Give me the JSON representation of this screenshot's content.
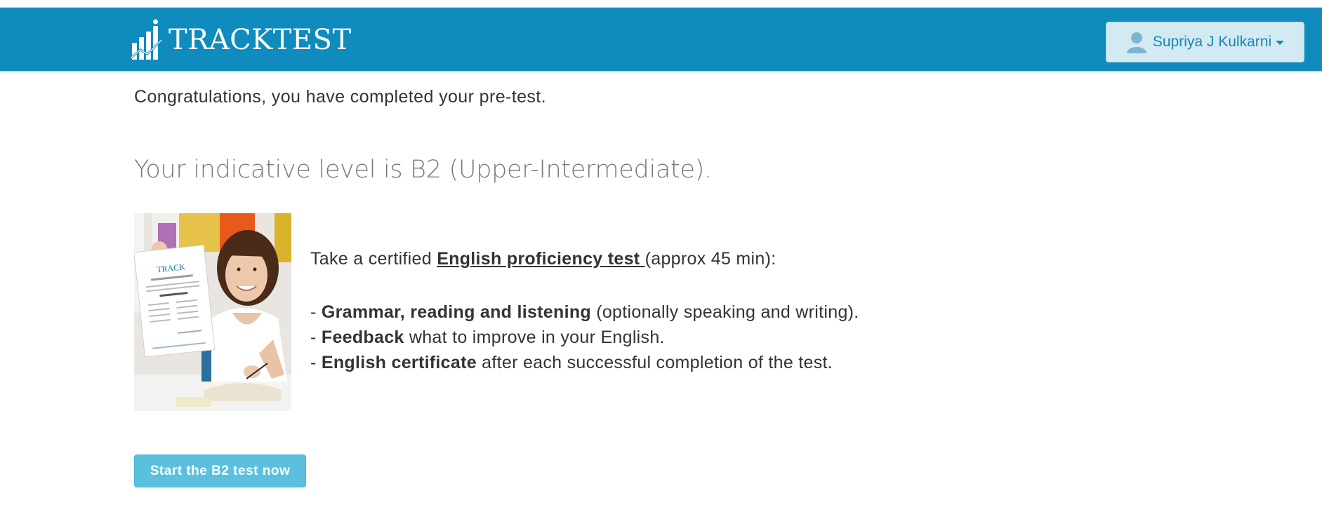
{
  "header": {
    "brand": "TRACKTEST",
    "brand_color": "#0f8bbd",
    "user_menu": {
      "name": "Supriya J Kulkarni",
      "icon": "user-icon"
    }
  },
  "main": {
    "congrats": "Congratulations, you have completed your pre-test.",
    "level": "Your indicative level is B2 (Upper-Intermediate).",
    "photo": {
      "certificate_brand": "TRACK"
    },
    "offer": {
      "prefix": "Take a certified ",
      "link": "English proficiency test ",
      "suffix": "(approx 45 min):"
    },
    "bullets": [
      {
        "dash": "- ",
        "bold": "Grammar, reading and listening",
        "rest": " (optionally speaking and writing)."
      },
      {
        "dash": "- ",
        "bold": "Feedback",
        "rest": " what to improve in your English."
      },
      {
        "dash": "- ",
        "bold": "English certificate",
        "rest": " after each successful completion of the test."
      }
    ],
    "start_button": "Start the B2 test now"
  }
}
